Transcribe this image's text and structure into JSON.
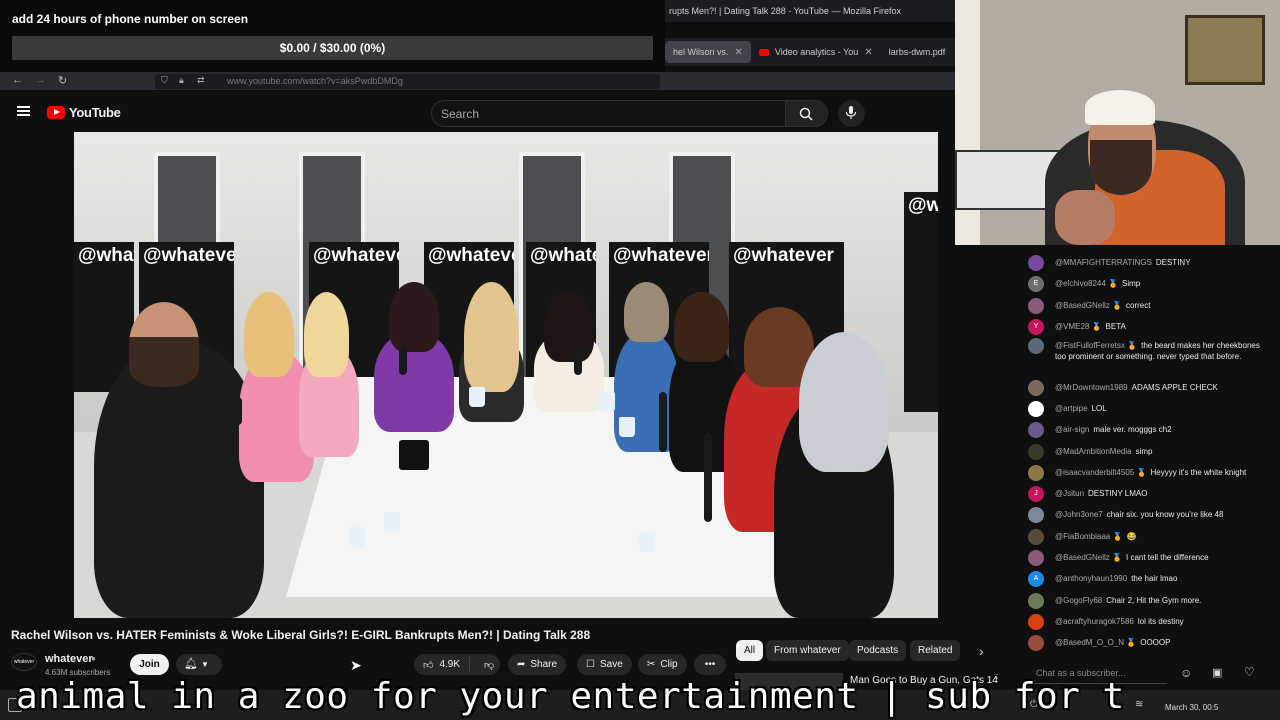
{
  "overlay": {
    "goal_title": "add 24 hours of phone number on screen",
    "goal_progress_text": "$0.00 / $30.00 (0%)",
    "goal_fraction": 0
  },
  "browser": {
    "window_title": "rupts Men?! | Dating Talk 288 - YouTube — Mozilla Firefox",
    "url": "www.youtube.com/watch?v=aksPwdbDMDg",
    "tabs": [
      {
        "label": "hel Wilson vs."
      },
      {
        "label": "Video analytics - You"
      },
      {
        "label": "larbs-dwm.pdf"
      }
    ]
  },
  "youtube": {
    "logo_text": "YouTube",
    "search_placeholder": "Search",
    "video": {
      "title": "Rachel Wilson vs. HATER Feminists & Woke Liberal Girls?! E-GIRL Bankrupts Men?! | Dating Talk 288",
      "banner_text": "@whatever"
    },
    "channel": {
      "avatar_text": "whatever",
      "name": "whatever",
      "subscribers": "4.63M subscribers",
      "join_label": "Join"
    },
    "actions": {
      "likes": "4.9K",
      "share": "Share",
      "save": "Save",
      "clip": "Clip",
      "more": "•••"
    },
    "chips": [
      "All",
      "From whatever",
      "Podcasts",
      "Related"
    ],
    "recommended_title": "Man Goes to Buy a Gun, Gets 14"
  },
  "chat": {
    "input_placeholder": "Chat as a subscriber...",
    "messages": [
      {
        "avatar": "",
        "color": "#7a4a9a",
        "author": "@MMAFIGHTERRATINGS",
        "text": "DESTINY"
      },
      {
        "avatar": "E",
        "color": "#6e6e6e",
        "author": "@elchivo8244 🏅",
        "text": "Simp"
      },
      {
        "avatar": "",
        "color": "#8a5a7a",
        "author": "@BasedGNellz 🏅",
        "text": "correct"
      },
      {
        "avatar": "Y",
        "color": "#c2185b",
        "author": "@VME28 🏅",
        "text": "BETA"
      },
      {
        "avatar": "",
        "color": "#5a6a7a",
        "author": "@FistFullofFerretsx 🏅",
        "text": "the beard makes her cheekbones too prominent or something. never typed that before."
      },
      {
        "avatar": "",
        "color": "#7a6a5a",
        "author": "@MrDowntown1989",
        "text": "ADAMS APPLE CHECK"
      },
      {
        "avatar": "",
        "color": "#ffffff",
        "author": "@artpipe",
        "text": "LOL"
      },
      {
        "avatar": "",
        "color": "#6a5a8a",
        "author": "@air-sign",
        "text": "male ver. mogggs ch2"
      },
      {
        "avatar": "",
        "color": "#3a3a2a",
        "author": "@MadAmbitionMedia",
        "text": "simp"
      },
      {
        "avatar": "",
        "color": "#8a7a4a",
        "author": "@isaacvanderbilt4505 🏅",
        "text": "Heyyyy it's the white knight"
      },
      {
        "avatar": "J",
        "color": "#c2185b",
        "author": "@Jsitun",
        "text": "DESTINY LMAO"
      },
      {
        "avatar": "",
        "color": "#7a8a9a",
        "author": "@John3one7",
        "text": "chair six. you know you're like 48"
      },
      {
        "avatar": "",
        "color": "#5a4a3a",
        "author": "@FiaBombiaaa 🏅",
        "text": "😂"
      },
      {
        "avatar": "",
        "color": "#8a5a7a",
        "author": "@BasedGNellz 🏅",
        "text": "I cant tell the difference"
      },
      {
        "avatar": "A",
        "color": "#1e88e5",
        "author": "@anthonyhaun1990",
        "text": "the hair lmao"
      },
      {
        "avatar": "",
        "color": "#6a7a5a",
        "author": "@GogoFly68",
        "text": "Chair 2, Hit the Gym more."
      },
      {
        "avatar": "",
        "color": "#d84315",
        "author": "@acraftyhuragok7586",
        "text": "lol its destiny"
      },
      {
        "avatar": "",
        "color": "#9a4a3a",
        "author": "@BasedM_O_O_N 🏅",
        "text": "OOOOP"
      }
    ]
  },
  "ticker": "animal in a zoo for your entertainment | sub for t",
  "clock": "March 30, 00:5"
}
